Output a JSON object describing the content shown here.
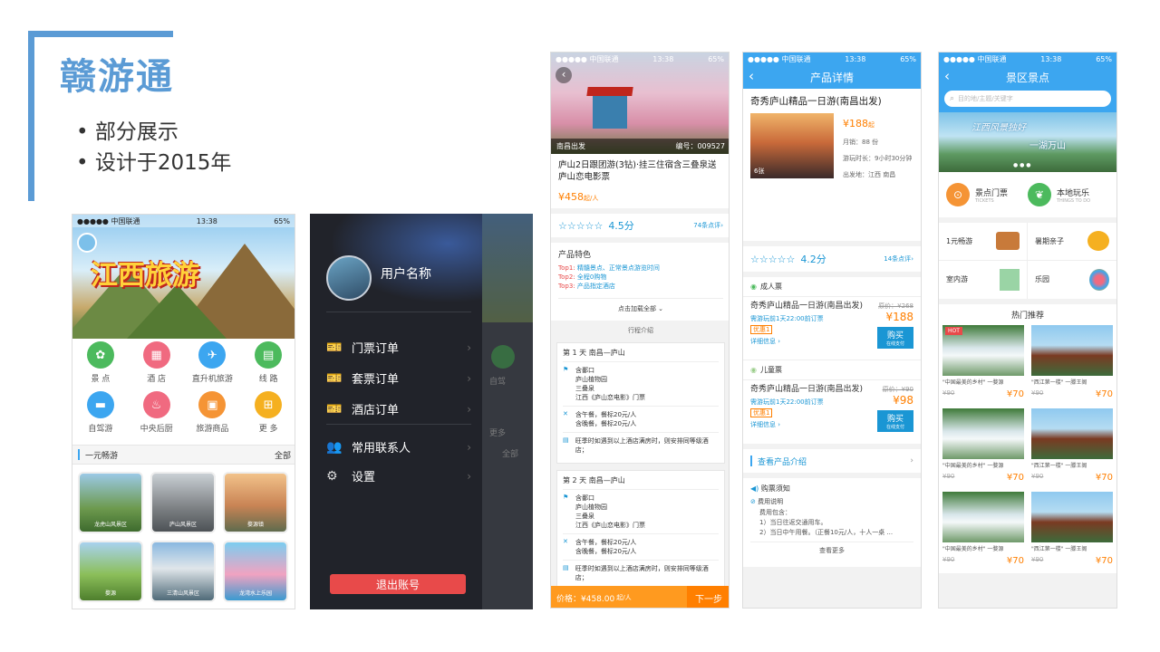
{
  "heading": {
    "title": "赣游通",
    "bullets": [
      "部分展示",
      "设计于2015年"
    ]
  },
  "colors": {
    "accent": "#5b9bd5",
    "nav_blue": "#3ca6f0",
    "orange": "#ff7f00",
    "dark_menu": "#21232a",
    "logout_red": "#e84a4a"
  },
  "status": {
    "carrier": "●●●●● 中国联通",
    "time": "13:38",
    "battery": "65%"
  },
  "home": {
    "banner_text": "江西旅游",
    "icons": [
      {
        "label": "景 点",
        "color": "#4cba5d",
        "icon": "scenic-icon"
      },
      {
        "label": "酒 店",
        "color": "#f06a80",
        "icon": "hotel-icon"
      },
      {
        "label": "直升机旅游",
        "color": "#3ca6f0",
        "icon": "helicopter-icon"
      },
      {
        "label": "线 路",
        "color": "#4cba5d",
        "icon": "route-icon"
      },
      {
        "label": "自驾游",
        "color": "#3ca6f0",
        "icon": "car-icon"
      },
      {
        "label": "中央后厨",
        "color": "#f06a80",
        "icon": "kitchen-icon"
      },
      {
        "label": "旅游商品",
        "color": "#f59435",
        "icon": "goods-icon"
      },
      {
        "label": "更 多",
        "color": "#f5b020",
        "icon": "more-icon"
      }
    ],
    "section_title": "一元畅游",
    "section_more": "全部",
    "thumbs": [
      "龙虎山风景区",
      "庐山风景区",
      "婺源镇",
      "婺源",
      "三清山风景区",
      "龙湾水上乐园"
    ]
  },
  "drawer": {
    "username": "用户名称",
    "menu": [
      {
        "label": "门票订单",
        "icon": "ticket-icon"
      },
      {
        "label": "套票订单",
        "icon": "package-ticket-icon"
      },
      {
        "label": "酒店订单",
        "icon": "hotel-order-icon"
      },
      {
        "label": "常用联系人",
        "icon": "contacts-icon"
      },
      {
        "label": "设置",
        "icon": "gear-icon"
      }
    ],
    "logout": "退出账号",
    "behind": {
      "labels": [
        "自驾",
        "更多",
        "全部"
      ]
    }
  },
  "tour": {
    "image_left": "南昌出发",
    "image_code": "编号：009527",
    "title": "庐山2日跟团游(3钻)·挂三住宿含三叠泉送庐山恋电影票",
    "price": "¥458",
    "price_unit": "起/人",
    "rating": "4.5分",
    "reviews": "74条点评",
    "feature_title": "产品特色",
    "features": [
      {
        "k": "Top1:",
        "v": "精髓景点、正常景点游览时间"
      },
      {
        "k": "Top2:",
        "v": "全程0购物"
      },
      {
        "k": "Top3:",
        "v": "产品指定酒店"
      }
    ],
    "load_all": "点击加载全部",
    "itinerary_label": "行程介绍",
    "days": [
      {
        "title": "第 1 天   南昌—庐山",
        "spots": [
          "含鄱口",
          "庐山植物园",
          "三叠泉",
          "江西《庐山恋电影》门票"
        ],
        "meals": [
          "含午餐，餐标20元/人",
          "含晚餐，餐标20元/人"
        ],
        "hotel": "旺季时如遇到以上酒店满房时，则安排同等级酒店；"
      },
      {
        "title": "第 2 天   南昌—庐山",
        "spots": [
          "含鄱口",
          "庐山植物园",
          "三叠泉",
          "江西《庐山恋电影》门票"
        ],
        "meals": [
          "含午餐，餐标20元/人",
          "含晚餐，餐标20元/人"
        ],
        "hotel": "旺季时如遇到以上酒店满房时，则安排同等级酒店；"
      }
    ],
    "bottom_price": "价格：¥458.00",
    "bottom_unit": "起/人",
    "next": "下一步"
  },
  "product": {
    "nav_title": "产品详情",
    "title": "奇秀庐山精品一日游(南昌出发)",
    "price": "¥188",
    "price_unit": "起",
    "sales": "月销：88 份",
    "duration": "游玩时长：9小时30分钟",
    "origin": "出发地：江西 南昌",
    "photo_count": "6张",
    "rating": "4.2分",
    "reviews": "14条点评",
    "tickets": [
      {
        "type": "成人票",
        "name": "奇秀庐山精品一日游(南昌出发)",
        "orig": "原价：¥268",
        "price": "¥188",
        "note": "需游玩前1天22:00前订票",
        "tag": "优惠1",
        "detail": "详细信息",
        "buy": "购买",
        "pay": "在线支付"
      },
      {
        "type": "儿童票",
        "name": "奇秀庐山精品一日游(南昌出发)",
        "orig": "原价：¥90",
        "price": "¥98",
        "note": "需游玩前1天22:00前订票",
        "tag": "优惠1",
        "detail": "详细信息",
        "buy": "购买",
        "pay": "在线支付"
      }
    ],
    "view_intro": "查看产品介绍",
    "notice_title": "购票须知",
    "notice_sub": "费用说明",
    "notice_lines": [
      "费用包含：",
      "1）当日往返交通用车。",
      "2）当日中午用餐。（正餐10元/人，十人一桌 ..."
    ],
    "more": "查看更多"
  },
  "scenic": {
    "nav_title": "景区景点",
    "search_placeholder": "目的地/主题/关键字",
    "banner_text": "江西风景独好",
    "banner_text2": "一湖万山",
    "cats": [
      {
        "title": "景点门票",
        "sub": "TICKETS",
        "color": "#f59435",
        "icon": "ticket-icon"
      },
      {
        "title": "本地玩乐",
        "sub": "THINGS TO DO",
        "color": "#4cba5d",
        "icon": "leaf-icon"
      }
    ],
    "tiles": [
      "1元畅游",
      "暑期亲子",
      "室内游",
      "乐园"
    ],
    "hot_title": "热门推荐",
    "hot_badge": "HOT",
    "items": [
      {
        "cap": "\"中国最美的乡村\" 一婺源",
        "old": "¥90",
        "price": "¥70",
        "kind": "water"
      },
      {
        "cap": "\"西江第一楼\" 一滕王阁",
        "old": "¥90",
        "price": "¥70",
        "kind": "tower"
      },
      {
        "cap": "\"中国最美的乡村\" 一婺源",
        "old": "¥90",
        "price": "¥70",
        "kind": "water"
      },
      {
        "cap": "\"西江第一楼\" 一滕王阁",
        "old": "¥90",
        "price": "¥70",
        "kind": "tower"
      },
      {
        "cap": "\"中国最美的乡村\" 一婺源",
        "old": "¥90",
        "price": "¥70",
        "kind": "water"
      },
      {
        "cap": "\"西江第一楼\" 一滕王阁",
        "old": "¥90",
        "price": "¥70",
        "kind": "tower"
      }
    ]
  }
}
